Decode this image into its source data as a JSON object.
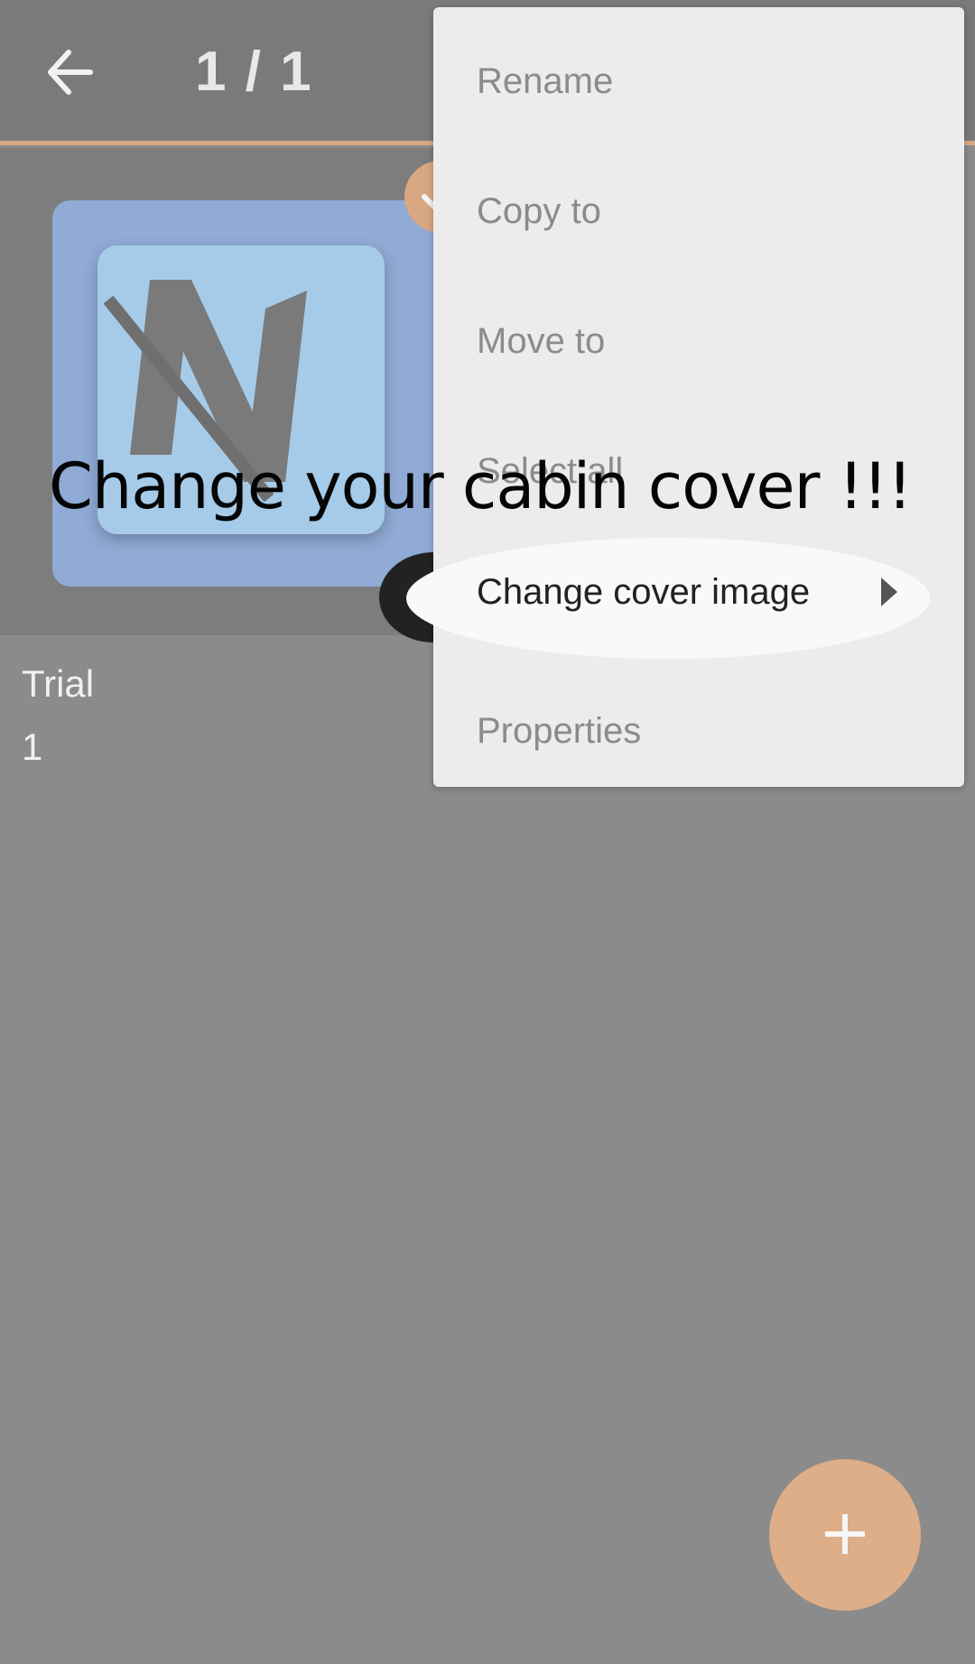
{
  "header": {
    "page_counter": "1 / 1"
  },
  "card": {
    "title": "Trial",
    "count": "1"
  },
  "menu": {
    "items": [
      {
        "label": "Rename"
      },
      {
        "label": "Copy to"
      },
      {
        "label": "Move to"
      },
      {
        "label": "Select all"
      },
      {
        "label": "Change cover image"
      },
      {
        "label": "Properties"
      }
    ]
  },
  "overlay": {
    "caption": "Change your cabin cover !!!"
  },
  "colors": {
    "accent": "#d9a883",
    "scrim": "#8b8b8b",
    "menu_bg": "#ececec"
  },
  "icons": {
    "back": "back-arrow-icon",
    "check": "check-icon",
    "submenu": "chevron-right-icon",
    "add": "plus-icon"
  }
}
